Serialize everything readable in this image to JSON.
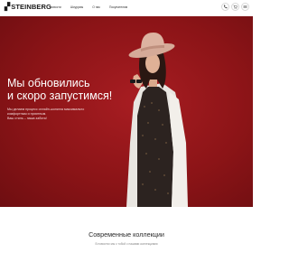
{
  "brand": {
    "logo_text": "STEINBERG"
  },
  "nav": {
    "items": [
      "Новости",
      "Шоурумы",
      "О нас",
      "Покупателям"
    ]
  },
  "header_icons": [
    "phone-icon",
    "cart-icon",
    "menu-icon"
  ],
  "hero": {
    "title_line1": "Мы обновились",
    "title_line2": "и скоро запустимся!",
    "text_line1": "Мы делаем процесс онлайн-шопинга максимально",
    "text_line2": "комфортным и приятным.",
    "text_line3": "Ваш стиль – наша забота!",
    "background_color": "#8c1417"
  },
  "collections": {
    "title": "Современные коллекции",
    "subtitle": "В новостях мы с тобой с нашими коллекциями"
  }
}
